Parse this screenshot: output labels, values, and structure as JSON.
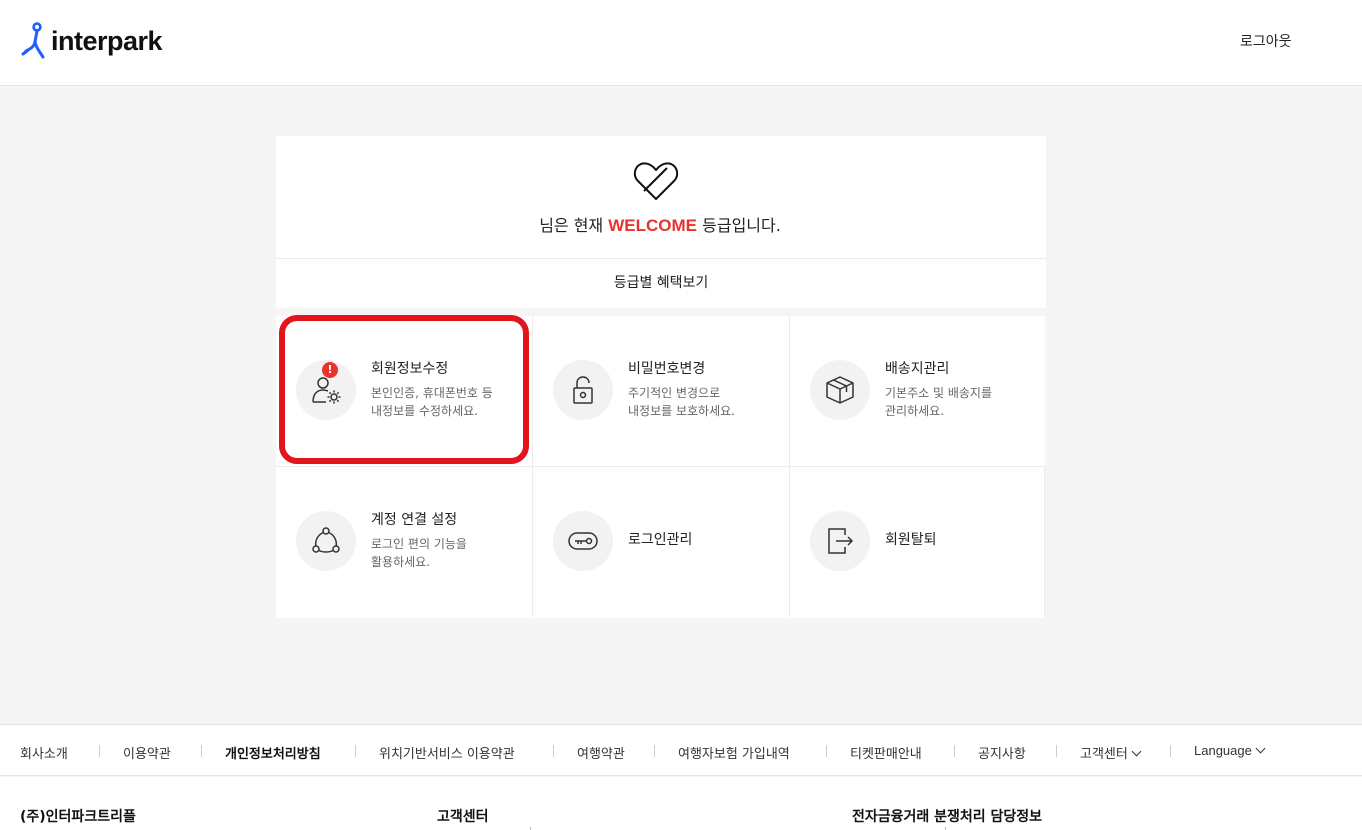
{
  "header": {
    "logo_text": "interpark",
    "logout_label": "로그아웃"
  },
  "welcome": {
    "grade_prefix": "님은 현재",
    "grade_name": "WELCOME",
    "grade_suffix": "등급입니다.",
    "benefit_label": "등급별 혜택보기"
  },
  "menu": {
    "items": [
      {
        "icon": "user-settings-icon",
        "title": "회원정보수정",
        "desc1": "본인인증, 휴대폰번호 등",
        "desc2": "내정보를 수정하세요."
      },
      {
        "icon": "padlock-icon",
        "title": "비밀번호변경",
        "desc1": "주기적인 변경으로",
        "desc2": "내정보를 보호하세요.",
        "badge": "!"
      },
      {
        "icon": "box-icon",
        "title": "배송지관리",
        "desc1": "기본주소 및 배송지를",
        "desc2": "관리하세요."
      },
      {
        "icon": "link-network-icon",
        "title": "계정 연결 설정",
        "desc1": "로그인 편의 기능을",
        "desc2": "활용하세요."
      },
      {
        "icon": "key-icon",
        "title": "로그인관리"
      },
      {
        "icon": "exit-icon",
        "title": "회원탈퇴"
      }
    ]
  },
  "footer": {
    "nav": [
      "회사소개",
      "이용약관",
      "개인정보처리방침",
      "위치기반서비스 이용약관",
      "여행약관",
      "여행자보험 가입내역",
      "티켓판매안내",
      "공지사항",
      "고객센터",
      "Language"
    ],
    "company_label": "(주)인터파크트리플",
    "customer_center_label": "고객센터",
    "dispute_label": "전자금융거래 분쟁처리 담당정보"
  },
  "colors": {
    "accent_red": "#e8342d",
    "highlight_red": "#e3141c",
    "logo_blue": "#1f5eff"
  }
}
